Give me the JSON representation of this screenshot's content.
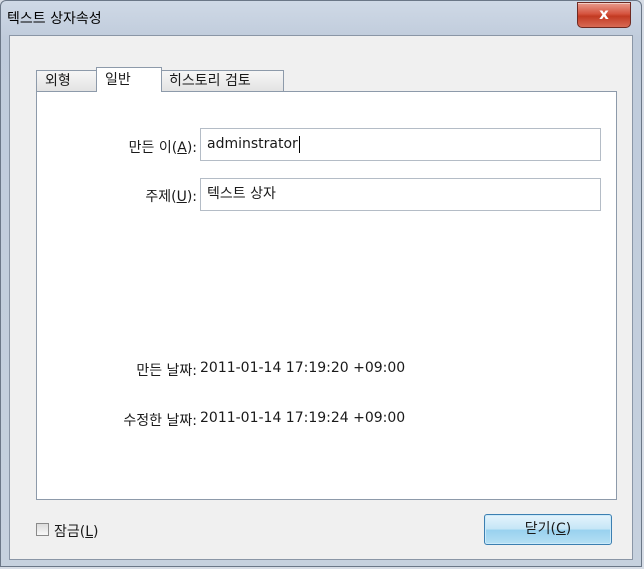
{
  "window": {
    "title": "텍스트 상자속성",
    "close_glyph": "x"
  },
  "tabs": [
    {
      "label": "외형",
      "active": false
    },
    {
      "label": "일반",
      "active": true
    },
    {
      "label": "히스토리 검토",
      "active": false
    }
  ],
  "fields": {
    "author": {
      "label_pre": "만든 이(",
      "mnemonic": "A",
      "label_post": "):",
      "value": "adminstrator"
    },
    "subject": {
      "label_pre": "주제(",
      "mnemonic": "U",
      "label_post": "):",
      "value": "텍스트 상자"
    }
  },
  "info": {
    "created_label": "만든 날짜:",
    "created_value": "2011-01-14 17:19:20 +09:00",
    "modified_label": "수정한 날짜:",
    "modified_value": "2011-01-14 17:19:24 +09:00"
  },
  "lock": {
    "label_pre": "잠금(",
    "mnemonic": "L",
    "label_post": ")",
    "checked": false
  },
  "close_button": {
    "label_pre": "닫기(",
    "mnemonic": "C",
    "label_post": ")"
  }
}
